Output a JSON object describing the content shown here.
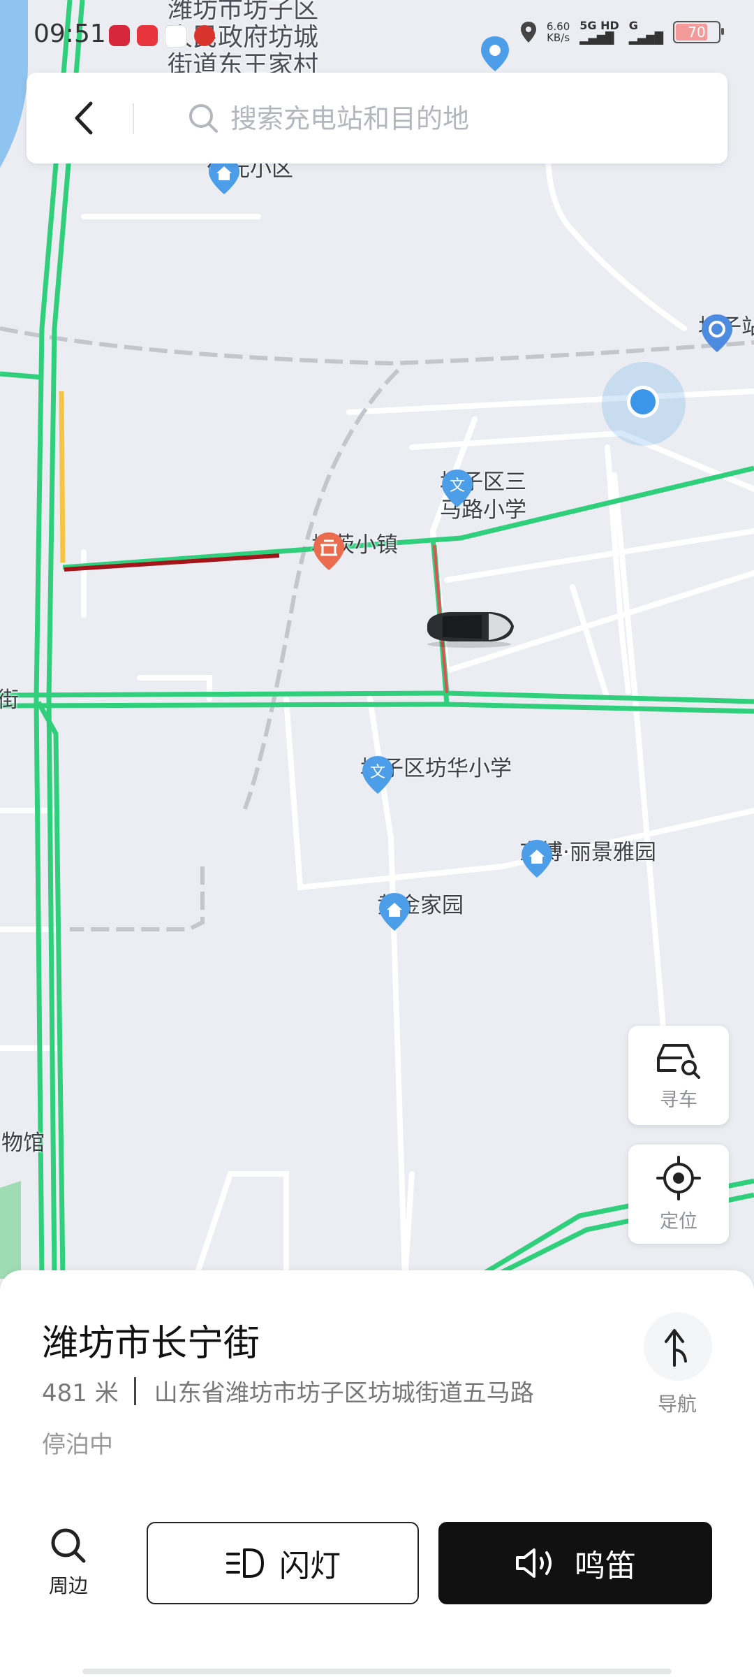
{
  "status_bar": {
    "time": "09:51",
    "net_speed_value": "6.60",
    "net_speed_unit": "KB/s",
    "signal_1": "5G HD",
    "signal_2": "G",
    "battery": "70"
  },
  "search": {
    "placeholder": "搜索充电站和目的地",
    "value": ""
  },
  "map": {
    "labels": {
      "top_line1": "潍坊市坊子区",
      "top_line2": "人民政府坊城",
      "top_line3": "街道东王家村",
      "jiayuan": "佳元小区",
      "fangzi_station": "坊子站",
      "school_3rd_line1": "坊子区三",
      "school_3rd_line2": "马路小学",
      "fangcha_town": "坊茨小镇",
      "street_left": "街",
      "fanghua_school": "坊子区坊华小学",
      "jingbo_garden": "京博·丽景雅园",
      "huangjin_garden": "黄金家园",
      "museum_partial": "物馆"
    },
    "colors": {
      "road_smooth": "#2fcf7c",
      "road_slow": "#f6c443",
      "road_congested": "#a3151b",
      "poi_blue": "#4d9ee9",
      "poi_orange": "#ea6b4d"
    }
  },
  "fab": {
    "find_car": "寻车",
    "locate": "定位"
  },
  "location_card": {
    "title": "潍坊市长宁街",
    "distance": "481 米",
    "address": "山东省潍坊市坊子区坊城街道五马路",
    "status": "停泊中",
    "nav_label": "导航"
  },
  "actions": {
    "nearby": "周边",
    "flash": "闪灯",
    "horn": "鸣笛"
  }
}
